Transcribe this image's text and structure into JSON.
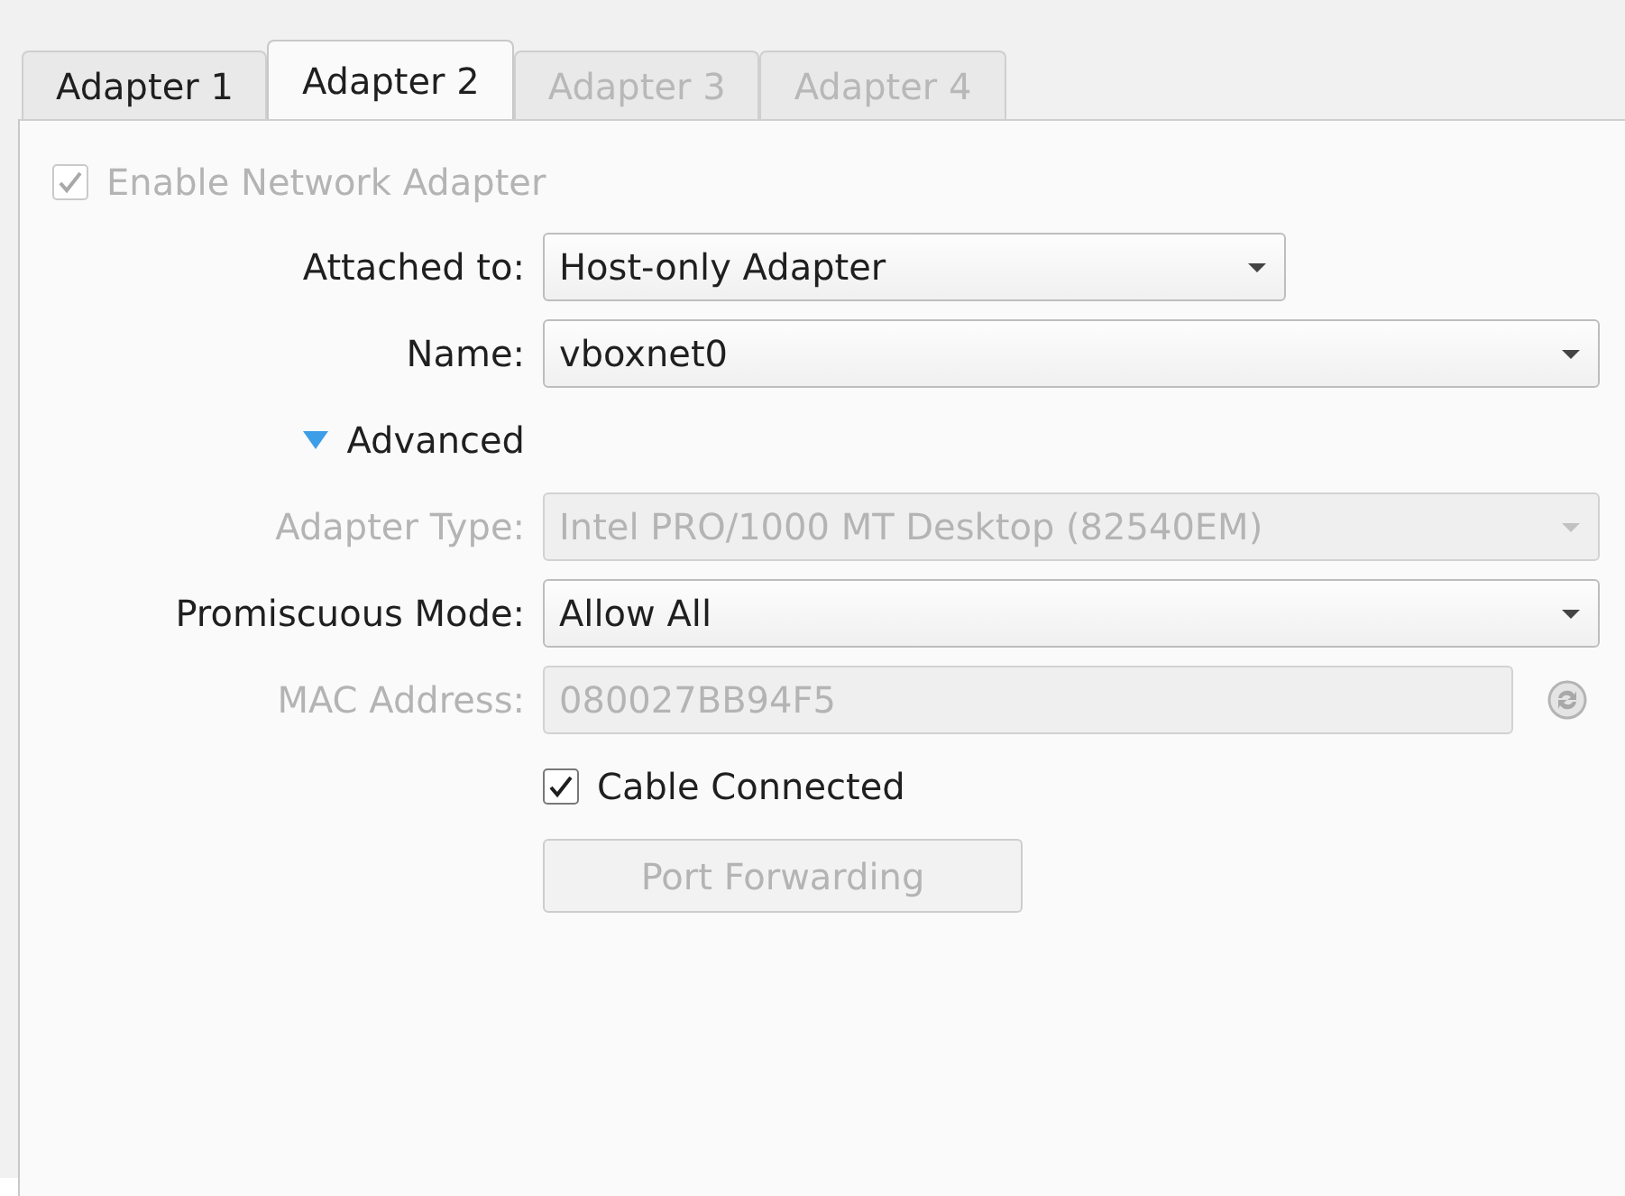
{
  "tabs": [
    {
      "label": "Adapter 1",
      "selected": false,
      "disabled": false
    },
    {
      "label": "Adapter 2",
      "selected": true,
      "disabled": false
    },
    {
      "label": "Adapter 3",
      "selected": false,
      "disabled": true
    },
    {
      "label": "Adapter 4",
      "selected": false,
      "disabled": true
    }
  ],
  "enable_adapter": {
    "label": "Enable Network Adapter",
    "checked": true,
    "disabled": true
  },
  "rows": [
    {
      "kind": "combo",
      "label": "Attached to:",
      "value": "Host-only Adapter",
      "disabled": false
    },
    {
      "kind": "combo",
      "label": "Name:",
      "value": "vboxnet0",
      "disabled": false
    },
    {
      "kind": "expander",
      "label": "Advanced",
      "expanded": true
    },
    {
      "kind": "combo",
      "label": "Adapter Type:",
      "value": "Intel PRO/1000 MT Desktop (82540EM)",
      "disabled": true
    },
    {
      "kind": "combo",
      "label": "Promiscuous Mode:",
      "value": "Allow All",
      "disabled": false
    },
    {
      "kind": "input",
      "label": "MAC Address:",
      "value": "080027BB94F5",
      "disabled": true
    },
    {
      "kind": "checkbox",
      "label": "Cable Connected",
      "checked": true,
      "disabled": false
    },
    {
      "kind": "button",
      "label": "Port Forwarding",
      "disabled": true
    }
  ]
}
